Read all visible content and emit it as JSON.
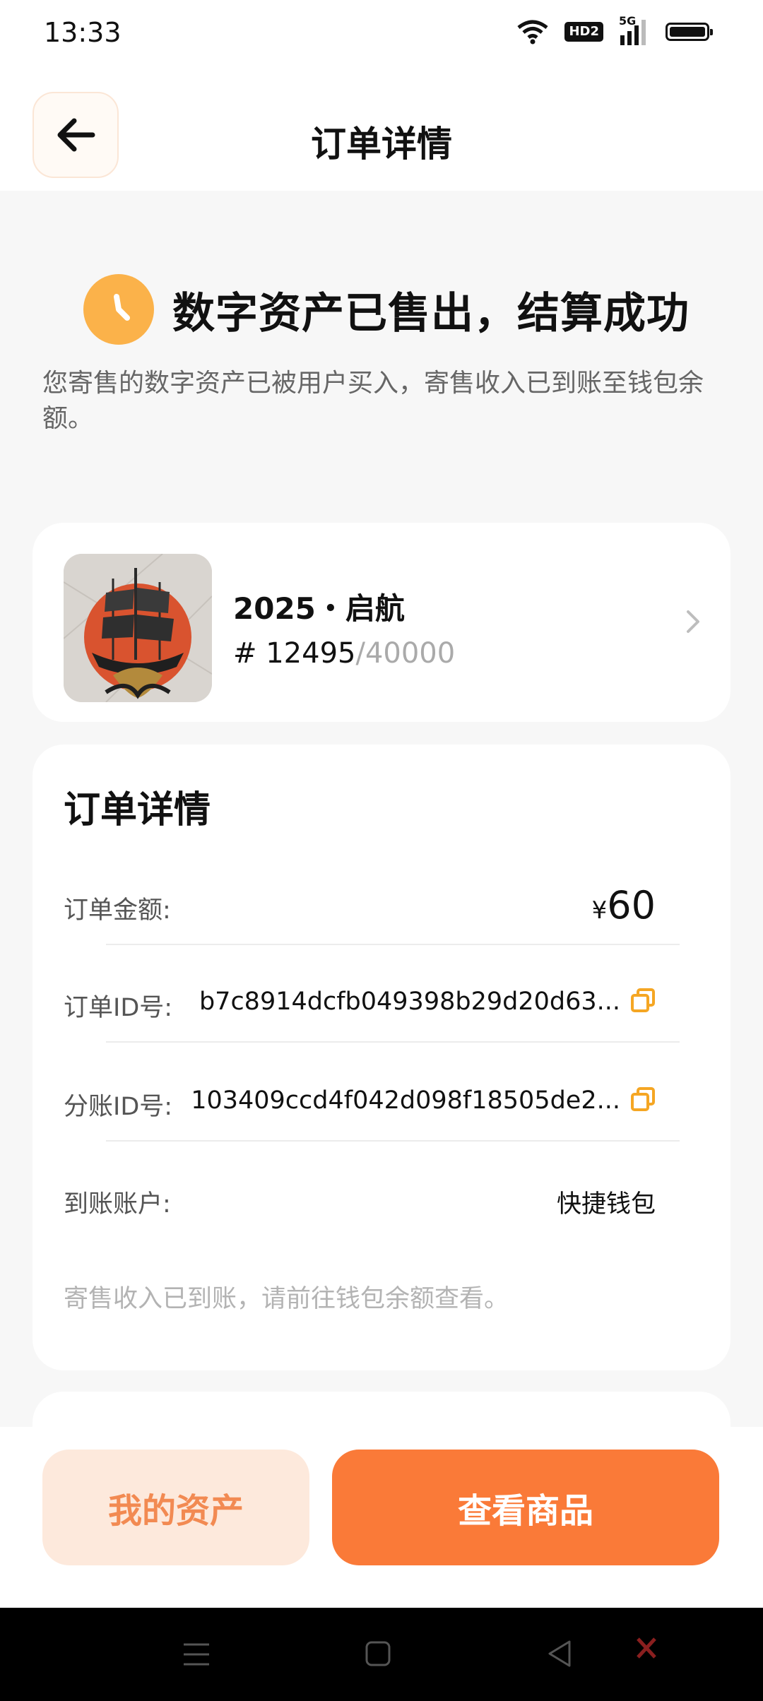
{
  "status_bar": {
    "time": "13:33",
    "hd_label": "HD2",
    "network": "5G"
  },
  "header": {
    "title": "订单详情"
  },
  "success": {
    "title": "数字资产已售出，结算成功",
    "description": "您寄售的数字资产已被用户买入，寄售收入已到账至钱包余额。"
  },
  "product": {
    "name": "2025・启航",
    "serial_prefix": "# ",
    "serial_number": "12495",
    "serial_total": "/40000"
  },
  "details": {
    "title": "订单详情",
    "amount_label": "订单金额:",
    "amount_currency": "¥",
    "amount_value": "60",
    "order_id_label": "订单ID号:",
    "order_id_value": "b7c8914dcfb049398b29d20d63...",
    "split_id_label": "分账ID号:",
    "split_id_value": "103409ccd4f042d098f18505de2...",
    "account_label": "到账账户:",
    "account_value": "快捷钱包",
    "note": "寄售收入已到账，请前往钱包余额查看。"
  },
  "actions": {
    "my_assets": "我的资产",
    "view_product": "查看商品"
  },
  "colors": {
    "accent": "#fa7a38",
    "accent_light": "#fde9dc",
    "clock": "#fbb24a",
    "copy_icon": "#f5a623"
  }
}
